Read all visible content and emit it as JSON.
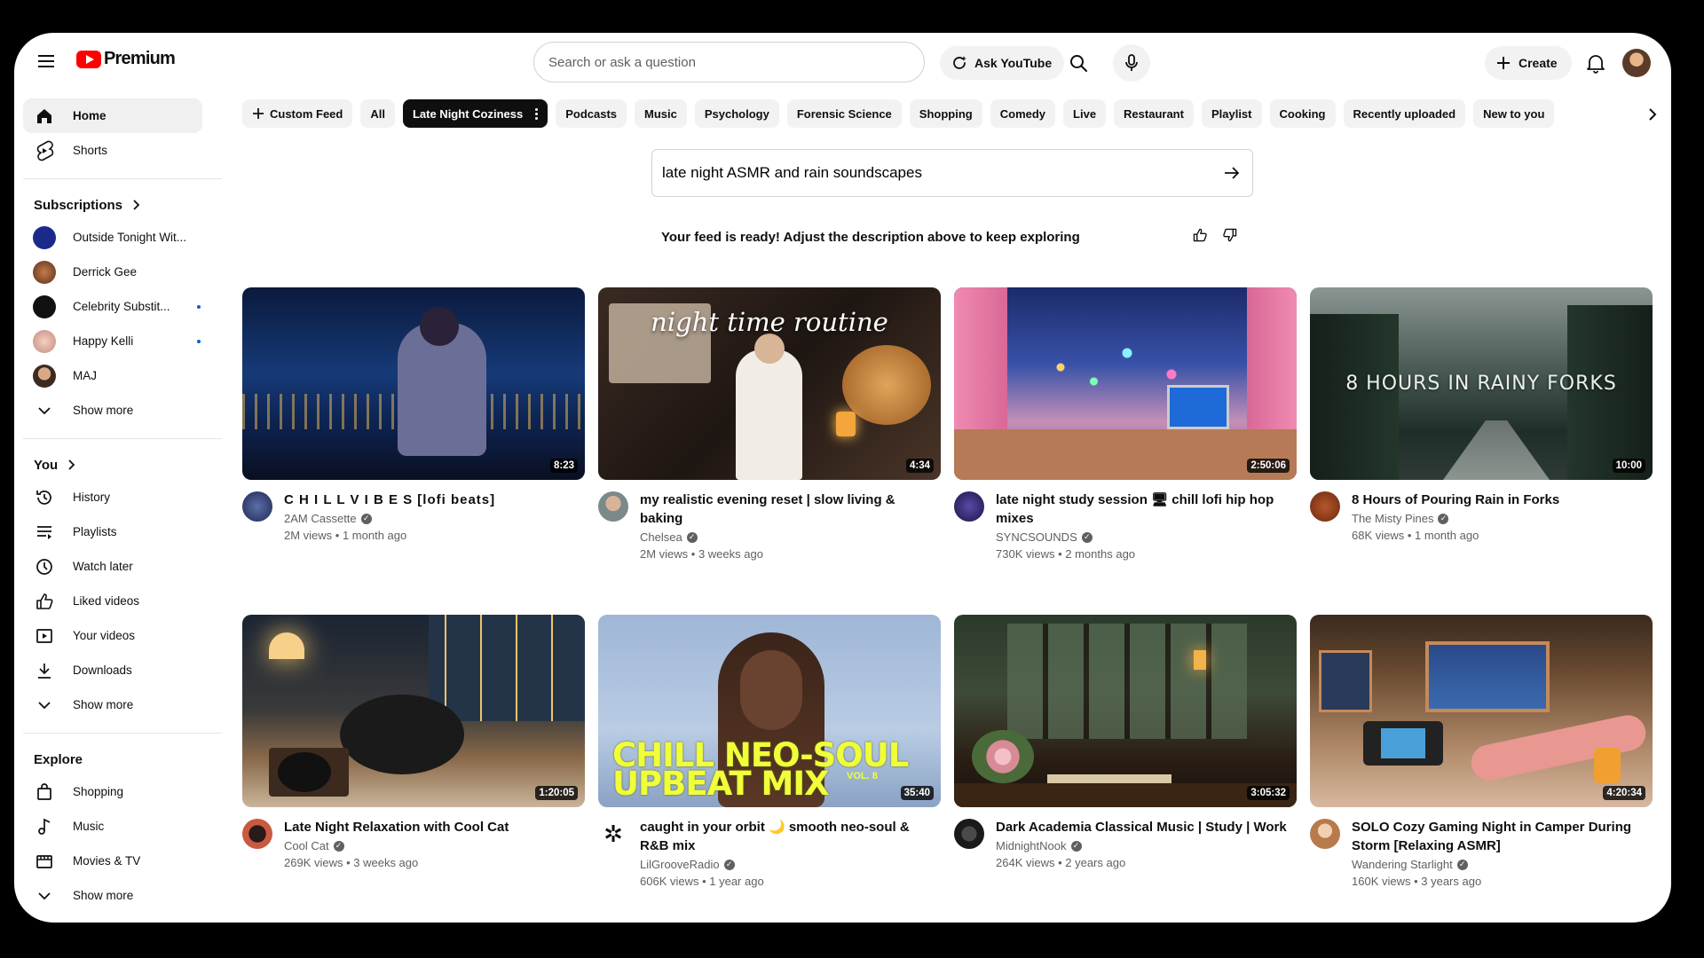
{
  "header": {
    "logo_text": "Premium",
    "search_placeholder": "Search or ask a question",
    "ask_label": "Ask YouTube",
    "create_label": "Create"
  },
  "sidebar": {
    "main": [
      {
        "label": "Home",
        "icon": "home-icon"
      },
      {
        "label": "Shorts",
        "icon": "shorts-icon"
      }
    ],
    "subscriptions_title": "Subscriptions",
    "subscriptions": [
      {
        "label": "Outside Tonight Wit...",
        "color": "#1b2a8a",
        "dot": false
      },
      {
        "label": "Derrick Gee",
        "color": "#7a4a2a",
        "dot": false
      },
      {
        "label": "Celebrity Substit...",
        "color": "#111111",
        "dot": true
      },
      {
        "label": "Happy Kelli",
        "color": "#d9a6a0",
        "dot": true
      },
      {
        "label": "MAJ",
        "color": "#6a5040",
        "dot": false
      }
    ],
    "show_more": "Show more",
    "you_title": "You",
    "you_items": [
      {
        "label": "History",
        "icon": "history-icon"
      },
      {
        "label": "Playlists",
        "icon": "playlists-icon"
      },
      {
        "label": "Watch later",
        "icon": "watch-later-icon"
      },
      {
        "label": "Liked videos",
        "icon": "thumbs-up-icon"
      },
      {
        "label": "Your videos",
        "icon": "your-videos-icon"
      },
      {
        "label": "Downloads",
        "icon": "download-icon"
      }
    ],
    "explore_title": "Explore",
    "explore_items": [
      {
        "label": "Shopping",
        "icon": "shopping-bag-icon"
      },
      {
        "label": "Music",
        "icon": "music-note-icon"
      },
      {
        "label": "Movies & TV",
        "icon": "film-icon"
      }
    ]
  },
  "chips": {
    "custom_feed": "Custom Feed",
    "items": [
      "All",
      "Late Night Coziness",
      "Podcasts",
      "Music",
      "Psychology",
      "Forensic Science",
      "Shopping",
      "Comedy",
      "Live",
      "Restaurant",
      "Playlist",
      "Cooking",
      "Recently uploaded",
      "New to you"
    ],
    "active": "Late Night Coziness"
  },
  "prompt": {
    "value": "late night ASMR and rain soundscapes",
    "feed_message": "Your feed is ready! Adjust the description above to keep exploring"
  },
  "videos": [
    {
      "title": "C H I L L  V I B E S [lofi beats]",
      "channel": "2AM Cassette",
      "verified": true,
      "stats": "2M views • 1 month ago",
      "duration": "8:23",
      "overlay": ""
    },
    {
      "title": "my realistic evening reset | slow living & baking",
      "channel": "Chelsea",
      "verified": true,
      "stats": "2M views • 3 weeks ago",
      "duration": "4:34",
      "overlay": "night time routine"
    },
    {
      "title": "late night study session 🖥 chill lofi hip hop mixes",
      "channel": "SYNCSOUNDS",
      "verified": true,
      "stats": "730K views • 2 months ago",
      "duration": "2:50:06",
      "overlay": ""
    },
    {
      "title": "8 Hours of Pouring Rain in Forks",
      "channel": "The Misty Pines",
      "verified": true,
      "stats": "68K views • 1 month ago",
      "duration": "10:00",
      "overlay": "8 HOURS IN RAINY FORKS"
    },
    {
      "title": "Late Night Relaxation with Cool Cat",
      "channel": "Cool Cat",
      "verified": true,
      "stats": "269K views • 3 weeks ago",
      "duration": "1:20:05",
      "overlay": ""
    },
    {
      "title": "caught in your orbit 🌙 smooth neo-soul & R&B mix",
      "channel": "LilGrooveRadio",
      "verified": true,
      "stats": "606K views • 1 year ago",
      "duration": "35:40",
      "overlay": "CHILL NEO-SOUL UPBEAT MIX",
      "overlay_sub": "VOL. 8"
    },
    {
      "title": "Dark Academia Classical Music | Study | Work",
      "channel": "MidnightNook",
      "verified": true,
      "stats": "264K views • 2 years ago",
      "duration": "3:05:32",
      "overlay": ""
    },
    {
      "title": "SOLO Cozy Gaming Night in Camper During Storm [Relaxing ASMR]",
      "channel": "Wandering Starlight",
      "verified": true,
      "stats": "160K views • 3 years ago",
      "duration": "4:20:34",
      "overlay": ""
    }
  ],
  "colors": {
    "brand_red": "#ff0000",
    "chip_active_bg": "#0f0f0f",
    "link_dot": "#065fd4"
  }
}
